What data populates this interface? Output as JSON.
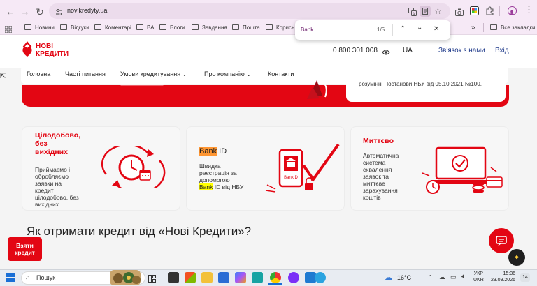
{
  "browser": {
    "url": "novikredyty.ua",
    "bookmarks": [
      "Новини",
      "Відгуки",
      "Коментарі",
      "ВА",
      "Блоги",
      "Завдання",
      "Пошта",
      "Корисні"
    ],
    "all_bookmarks": "Все закладки",
    "more_bookmarks": "»"
  },
  "find_bar": {
    "query": "Bank",
    "count": "1/5"
  },
  "site": {
    "logo_line1": "НОВІ",
    "logo_line2": "КРЕДИТИ",
    "phone": "0 800 301 008",
    "lang": "UA",
    "contact_link": "Зв'язок з нами",
    "login_link": "Вхід",
    "nav": [
      "Головна",
      "Часті питання",
      "Умови кредитування",
      "Про компанію",
      "Контакти"
    ],
    "banner_text": "розумінні Постанови НБУ від 05.10.2021 №100.",
    "cards": [
      {
        "title_lines": [
          "Цілодобово,",
          "без",
          "вихідних"
        ],
        "text_lines": [
          "Приймаємо і",
          "обробляємо",
          "заявки на",
          "кредит",
          "цілодобово, без",
          "вихідних"
        ]
      },
      {
        "title_highlight": "Bank",
        "title_rest": " ID",
        "text_lines": [
          "Швидка",
          "реєстрація за",
          "допомогою"
        ],
        "text_highlight": "Bank",
        "text_rest": " ID від НБУ",
        "icon_label": "BankID"
      },
      {
        "title_lines": [
          "Миттєво"
        ],
        "text_lines": [
          "Автоматична",
          "система",
          "схвалення",
          "заявок та",
          "миттєве",
          "зарахування",
          "коштів"
        ]
      }
    ],
    "cta_line1": "Взяти",
    "cta_line2": "кредит",
    "section_heading": "Як отримати кредит від «Нові Кредити»?"
  },
  "taskbar": {
    "search": "Пошук",
    "weather": "16°C",
    "lang_line1": "УКР",
    "lang_line2": "UKR",
    "time": "15:36",
    "date": "23.09.2026",
    "notifications": "14"
  },
  "colors": {
    "brand_red": "#e30613",
    "find_highlight_current": "#ff9632",
    "find_highlight_other": "#ffff00",
    "browser_tint": "#f6e9f6"
  }
}
